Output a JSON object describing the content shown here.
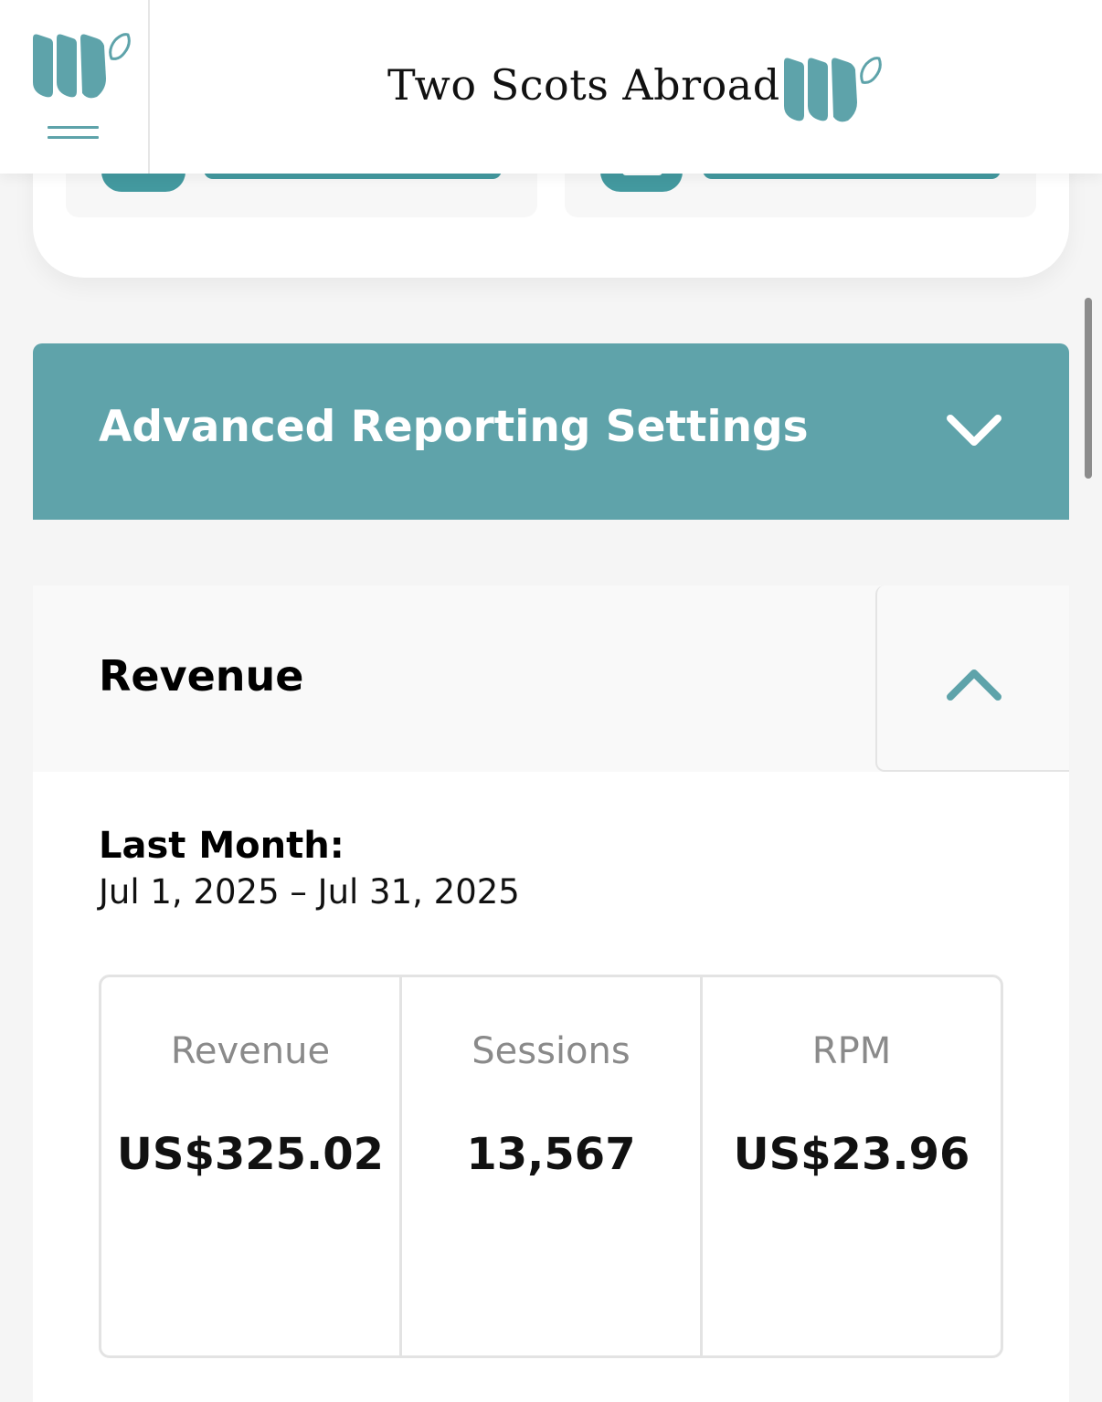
{
  "header": {
    "site_title": "Two Scots Abroad",
    "menu_logo_icon": "mediavine-leaf-logo-icon",
    "menu_icon": "hamburger-menu-icon",
    "brand_color": "#5ea3aa"
  },
  "advanced_settings": {
    "title": "Advanced Reporting Settings",
    "icon": "chevron-down-icon",
    "background_color": "#5fa3aa"
  },
  "revenue": {
    "title": "Revenue",
    "collapse_icon": "chevron-up-icon",
    "period_label": "Last Month:",
    "period_range": "Jul 1, 2025 – Jul 31, 2025",
    "stats": [
      {
        "label": "Revenue",
        "value": "US$325.02"
      },
      {
        "label": "Sessions",
        "value": "13,567"
      },
      {
        "label": "RPM",
        "value": "US$23.96"
      }
    ]
  }
}
